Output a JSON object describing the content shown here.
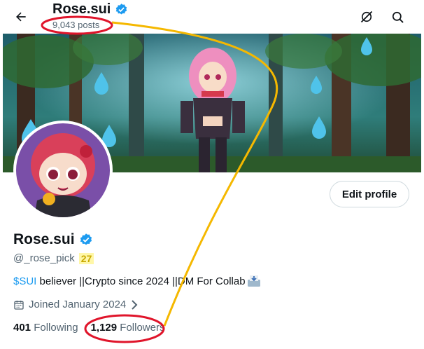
{
  "header": {
    "title": "Rose.sui",
    "posts_count": "9,043 posts"
  },
  "profile": {
    "display_name": "Rose.sui",
    "handle": "@_rose_pick",
    "handle_badge": "27",
    "bio_cashtag": "$SUI",
    "bio_text": " believer ||Crypto since 2024 ||DM For Collab",
    "joined": "Joined January 2024",
    "following_count": "401",
    "following_label": "Following",
    "followers_count": "1,129",
    "followers_label": "Followers"
  },
  "buttons": {
    "edit_profile": "Edit profile"
  },
  "colors": {
    "verified": "#1d9bf0",
    "annotation_red": "#e0152b",
    "annotation_yellow": "#f5b800"
  }
}
